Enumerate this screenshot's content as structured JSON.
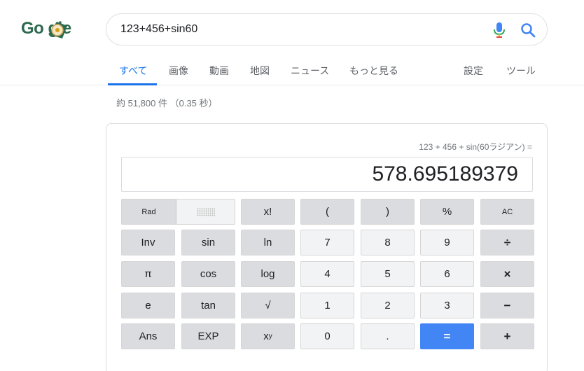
{
  "logo": {
    "text": "Go  gle"
  },
  "search": {
    "query": "123+456+sin60",
    "placeholder": ""
  },
  "tabs": [
    {
      "label": "すべて",
      "active": true
    },
    {
      "label": "画像"
    },
    {
      "label": "動画"
    },
    {
      "label": "地図"
    },
    {
      "label": "ニュース"
    },
    {
      "label": "もっと見る"
    },
    {
      "label": "設定"
    },
    {
      "label": "ツール"
    }
  ],
  "result_stats": "約 51,800 件 （0.35 秒）",
  "calculator": {
    "expression": "123 + 456 + sin(60ラジアン) =",
    "result": "578.695189379",
    "mode": "Rad",
    "keys": {
      "fact": "x!",
      "lparen": "(",
      "rparen": ")",
      "percent": "%",
      "ac": "AC",
      "inv": "Inv",
      "sin": "sin",
      "ln": "ln",
      "seven": "7",
      "eight": "8",
      "nine": "9",
      "divide": "÷",
      "pi": "π",
      "cos": "cos",
      "log": "log",
      "four": "4",
      "five": "5",
      "six": "6",
      "multiply": "×",
      "e": "e",
      "tan": "tan",
      "sqrt": "√",
      "one": "1",
      "two": "2",
      "three": "3",
      "minus": "−",
      "ans": "Ans",
      "exp": "EXP",
      "pow_base": "x",
      "pow_exp": "y",
      "zero": "0",
      "dot": ".",
      "equals": "=",
      "plus": "+"
    }
  },
  "colors": {
    "accent": "#1a73e8",
    "equals_key": "#4285f4",
    "logo": "#2d6a4f"
  }
}
